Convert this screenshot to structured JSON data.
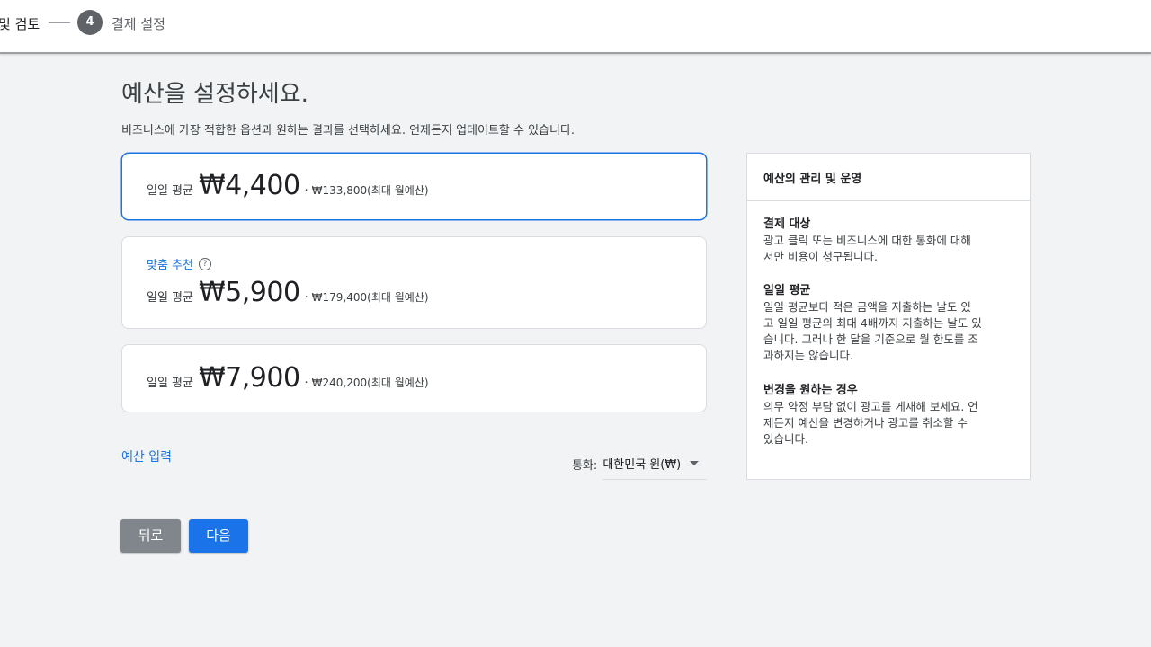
{
  "stepper": {
    "prev_label": "및 검토",
    "current_number": "4",
    "current_label": "결제 설정"
  },
  "page": {
    "title": "예산을 설정하세요.",
    "subtitle": "비즈니스에 가장 적합한 옵션과 원하는 결과를 선택하세요. 언제든지 업데이트할 수 있습니다."
  },
  "options": [
    {
      "daily_label": "일일 평균",
      "price": "₩4,400",
      "separator": "·",
      "monthly": "₩133,800(최대 월예산)",
      "selected": true
    },
    {
      "recommend_label": "맞춤 추천",
      "help_icon": "?",
      "daily_label": "일일 평균",
      "price": "₩5,900",
      "separator": "·",
      "monthly": "₩179,400(최대 월예산)",
      "selected": false
    },
    {
      "daily_label": "일일 평균",
      "price": "₩7,900",
      "separator": "·",
      "monthly": "₩240,200(최대 월예산)",
      "selected": false
    }
  ],
  "budget_input_link": "예산 입력",
  "currency": {
    "label": "통화:",
    "value": "대한민국 원(₩)",
    "icon": "caret-down-icon"
  },
  "buttons": {
    "back": "뒤로",
    "next": "다음"
  },
  "info_panel": {
    "header": "예산의 관리 및 운영",
    "sections": [
      {
        "title": "결제 대상",
        "lines": [
          "광고 클릭 또는 비즈니스에 대한 통화에 대해",
          "서만 비용이 청구됩니다."
        ]
      },
      {
        "title": "일일 평균",
        "lines": [
          "일일 평균보다 적은 금액을 지출하는 날도 있",
          "고 일일 평균의 최대 4배까지 지출하는 날도 있",
          "습니다. 그러나 한 달을 기준으로 월 한도를 조",
          "과하지는 않습니다."
        ]
      },
      {
        "title": "변경을 원하는 경우",
        "lines": [
          "의무 약정 부담 없이 광고를 게재해 보세요. 언",
          "제든지 예산을 변경하거나 광고를 취소할 수",
          "있습니다."
        ]
      }
    ]
  },
  "colors": {
    "accent": "#1a73e8",
    "background": "#f1f3f4",
    "step_circle": "#5f6368",
    "back_button": "#80868b"
  }
}
